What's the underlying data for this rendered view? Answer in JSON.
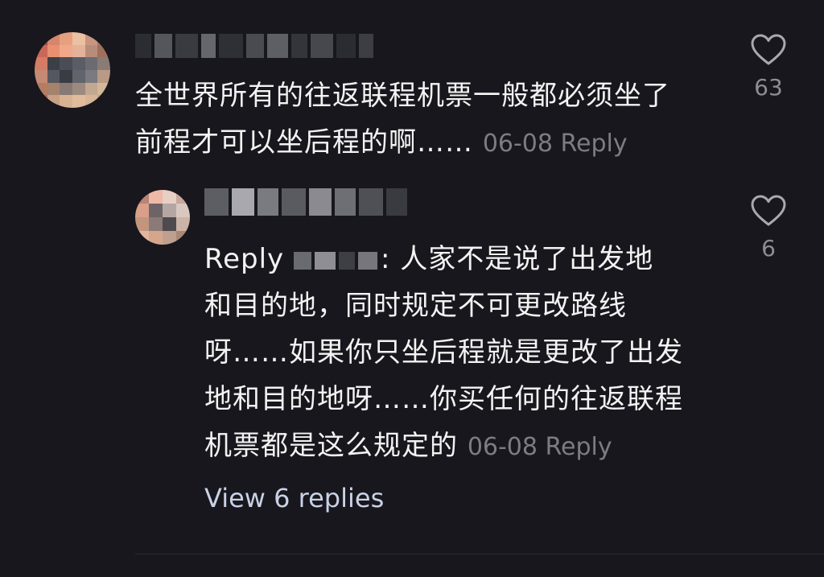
{
  "comment": {
    "text_line1": "全世界所有的往返联程机票一般都必须坐了",
    "text_line2": "前程才可以坐后程的啊……",
    "date": "06-08",
    "reply_label": "Reply",
    "like_count": "63"
  },
  "reply": {
    "prefix": "Reply",
    "text_line1": ": 人家不是说了出发地",
    "text_line2": "和目的地，同时规定不可更改路线",
    "text_line3": "呀……如果你只坐后程就是更改了出发",
    "text_line4": "地和目的地呀……你买任何的往返联程",
    "text_line5": "机票都是这么规定的",
    "date": "06-08",
    "reply_label": "Reply",
    "like_count": "6"
  },
  "view_replies_label": "View 6 replies",
  "icons": {
    "like": "heart-outline-icon"
  },
  "colors": {
    "background": "#17171d",
    "text": "#f3f3f3",
    "meta": "#7c7c82",
    "link": "#c9d1e6"
  }
}
